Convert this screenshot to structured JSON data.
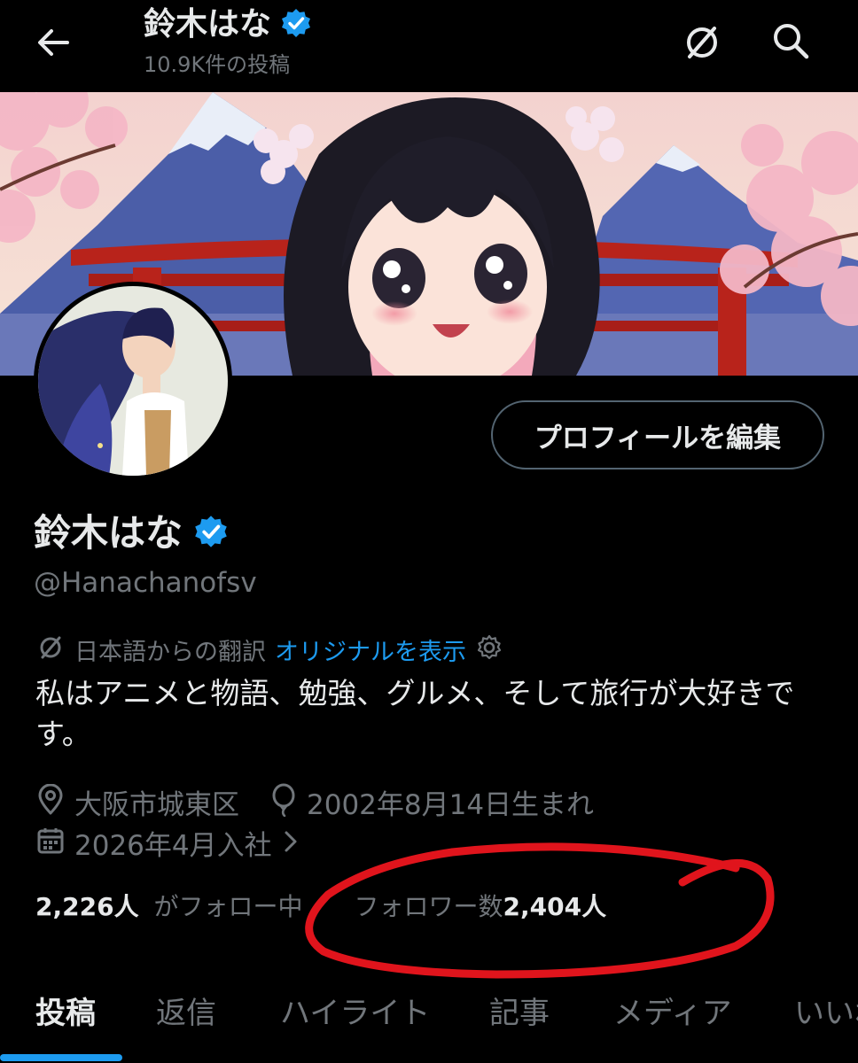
{
  "header": {
    "title": "鈴木はな",
    "post_count": "10.9K件の投稿"
  },
  "profile": {
    "edit_button": "プロフィールを編集",
    "name": "鈴木はな",
    "handle": "@Hanachanofsv",
    "translation_note": "日本語からの翻訳",
    "show_original": "オリジナルを表示",
    "bio": "私はアニメと物語、勉強、グルメ、そして旅行が大好きです。",
    "location": "大阪市城東区",
    "birthday": "2002年8月14日生まれ",
    "joined": "2026年4月入社",
    "following_count": "2,226人",
    "following_label": "がフォロー中",
    "followers_label": "フォロワー数",
    "followers_count": "2,404人"
  },
  "tabs": [
    {
      "label": "投稿",
      "active": true
    },
    {
      "label": "返信",
      "active": false
    },
    {
      "label": "ハイライト",
      "active": false
    },
    {
      "label": "記事",
      "active": false
    },
    {
      "label": "メディア",
      "active": false
    },
    {
      "label": "いいね",
      "active": false
    }
  ],
  "colors": {
    "background": "#000000",
    "text": "#e7e9ea",
    "muted": "#71767b",
    "accent": "#1d9bf0",
    "verified": "#1d9bf0",
    "annotation_circle": "#e0141c"
  },
  "icons": [
    "back-arrow-icon",
    "verified-badge-icon",
    "translate-icon",
    "search-icon",
    "location-pin-icon",
    "balloon-icon",
    "calendar-icon",
    "gear-icon",
    "chevron-right-icon"
  ]
}
